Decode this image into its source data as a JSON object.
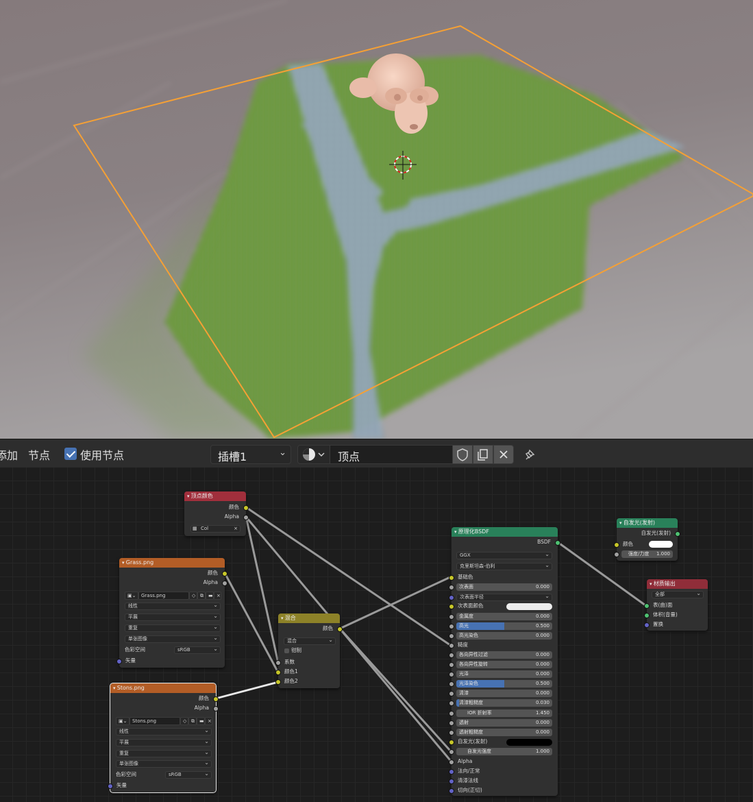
{
  "header": {
    "menu_add": "添加",
    "menu_node": "节点",
    "use_nodes_label": "使用节点",
    "slot_value": "插槽1",
    "material_name": "顶点"
  },
  "nodes": {
    "vertex_color": {
      "title": "顶点颜色",
      "out_color": "颜色",
      "out_alpha": "Alpha",
      "layer": "Col"
    },
    "grass": {
      "title": "Grass.png",
      "out_color": "颜色",
      "out_alpha": "Alpha",
      "image": "Grass.png",
      "interpolation": "线性",
      "projection": "平展",
      "extension": "重复",
      "source": "单张图像",
      "colorspace_label": "色彩空间",
      "colorspace": "sRGB",
      "in_vector": "矢量"
    },
    "stons": {
      "title": "Stons.png",
      "out_color": "颜色",
      "out_alpha": "Alpha",
      "image": "Stons.png",
      "interpolation": "线性",
      "projection": "平展",
      "extension": "重复",
      "source": "单张图像",
      "colorspace_label": "色彩空间",
      "colorspace": "sRGB",
      "in_vector": "矢量"
    },
    "mix": {
      "title": "混合",
      "out_color": "颜色",
      "blend": "混合",
      "clamp": "钳制",
      "in_fac": "系数",
      "in_color1": "颜色1",
      "in_color2": "颜色2"
    },
    "bsdf": {
      "title": "原理化BSDF",
      "out": "BSDF",
      "distribution": "GGX",
      "subsurface_method": "克里斯坦森-伯利",
      "base_color": "基础色",
      "subsurface": "次表面",
      "subsurface_value": "0.000",
      "subsurface_radius": "次表面半径",
      "subsurface_color": "次表面颜色",
      "metallic": "金属度",
      "metallic_value": "0.000",
      "specular": "高光",
      "specular_value": "0.500",
      "specular_value_num": 0.5,
      "specular_tint": "高光染色",
      "specular_tint_value": "0.000",
      "roughness": "糙度",
      "anisotropic": "各向异性过滤",
      "anisotropic_value": "0.000",
      "anisotropic_rotation": "各向异性旋转",
      "anisotropic_rotation_value": "0.000",
      "sheen": "光泽",
      "sheen_value": "0.000",
      "sheen_tint": "光泽染色",
      "sheen_tint_value": "0.500",
      "sheen_tint_value_num": 0.5,
      "clearcoat": "清漆",
      "clearcoat_value": "0.000",
      "clearcoat_roughness": "清漆粗糙度",
      "clearcoat_roughness_value": "0.030",
      "clearcoat_roughness_value_num": 0.03,
      "ior": "IOR 折射率",
      "ior_value": "1.450",
      "transmission": "透射",
      "transmission_value": "0.000",
      "transmission_roughness": "透射粗糙度",
      "transmission_roughness_value": "0.000",
      "emission": "自发光(发射)",
      "emission_strength": "自发光强度",
      "emission_strength_value": "1.000",
      "alpha": "Alpha",
      "normal": "法向/正常",
      "clearcoat_normal": "清漆法线",
      "tangent": "切向(正切)"
    },
    "emission": {
      "title": "自发光(发射)",
      "out": "自发光(发射)",
      "color": "颜色",
      "strength_label": "强度/力度",
      "strength_value": "1.000"
    },
    "output": {
      "title": "材质输出",
      "target": "全部",
      "surface": "表(曲)面",
      "volume": "体积(音量)",
      "displacement": "置换"
    }
  },
  "colors": {
    "accent_blue": "#4772b3",
    "texture_header": "#b35d26",
    "color_header": "#a12f3c",
    "shader_header": "#29815a",
    "mix_header": "#8d8228",
    "output_header": "#902d39",
    "selection_orange": "#f5a035"
  }
}
